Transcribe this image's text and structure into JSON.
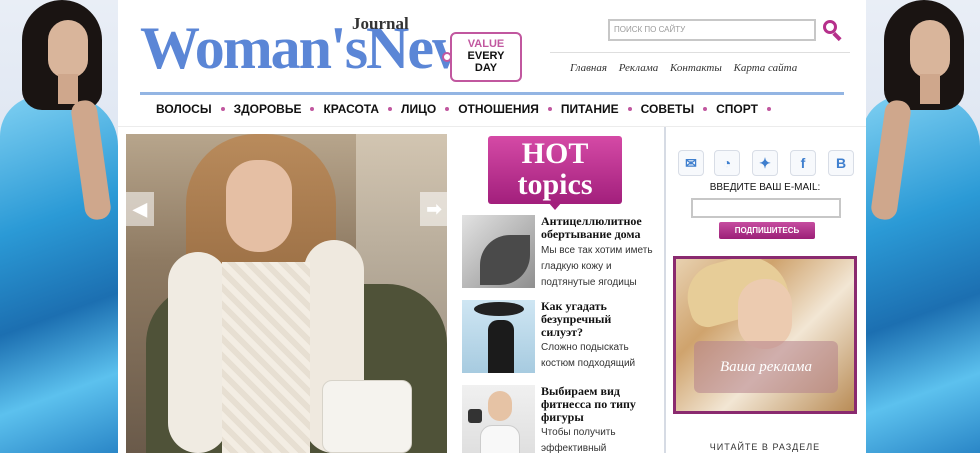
{
  "brand": {
    "logo_main": "Woman'sNews",
    "logo_sub": "Journal",
    "tag_line1": "VALUE",
    "tag_line2": "EVERY",
    "tag_line3": "DAY"
  },
  "search": {
    "placeholder": "ПОИСК ПО САЙТУ"
  },
  "top_links": [
    "Главная",
    "Реклама",
    "Контакты",
    "Карта сайта"
  ],
  "nav": [
    "ВОЛОСЫ",
    "ЗДОРОВЬЕ",
    "КРАСОТА",
    "ЛИЦО",
    "ОТНОШЕНИЯ",
    "ПИТАНИЕ",
    "СОВЕТЫ",
    "СПОРТ"
  ],
  "hot_topics": {
    "line1": "HOT",
    "line2": "topics"
  },
  "articles": [
    {
      "title": "Антицеллюлитное обертывание дома",
      "desc": "Мы все так хотим иметь гладкую кожу и подтянутые ягодицы"
    },
    {
      "title": "Как угадать безупречный силуэт?",
      "desc": "Сложно подыскать костюм подходящий"
    },
    {
      "title": "Выбираем вид фитнесса по типу фигуры",
      "desc": "Чтобы получить эффективный"
    }
  ],
  "sidebar": {
    "socials": [
      "mail-icon",
      "rss-icon",
      "twitter-icon",
      "facebook-icon",
      "vk-icon"
    ],
    "social_glyphs": [
      "✉",
      "◔",
      "✦",
      "f",
      "B"
    ],
    "email_label": "ВВЕДИТЕ ВАШ E-MAIL:",
    "subscribe_label": "ПОДПИШИТЕСЬ",
    "ad_label": "Ваша реклама",
    "section_label": "ЧИТАЙТЕ В РАЗДЕЛЕ"
  },
  "slider": {
    "prev_glyph": "◀",
    "next_glyph": "➡"
  },
  "colors": {
    "accent": "#b6308b",
    "logo_blue": "#5b86d6",
    "nav_line": "#93b5e3"
  }
}
